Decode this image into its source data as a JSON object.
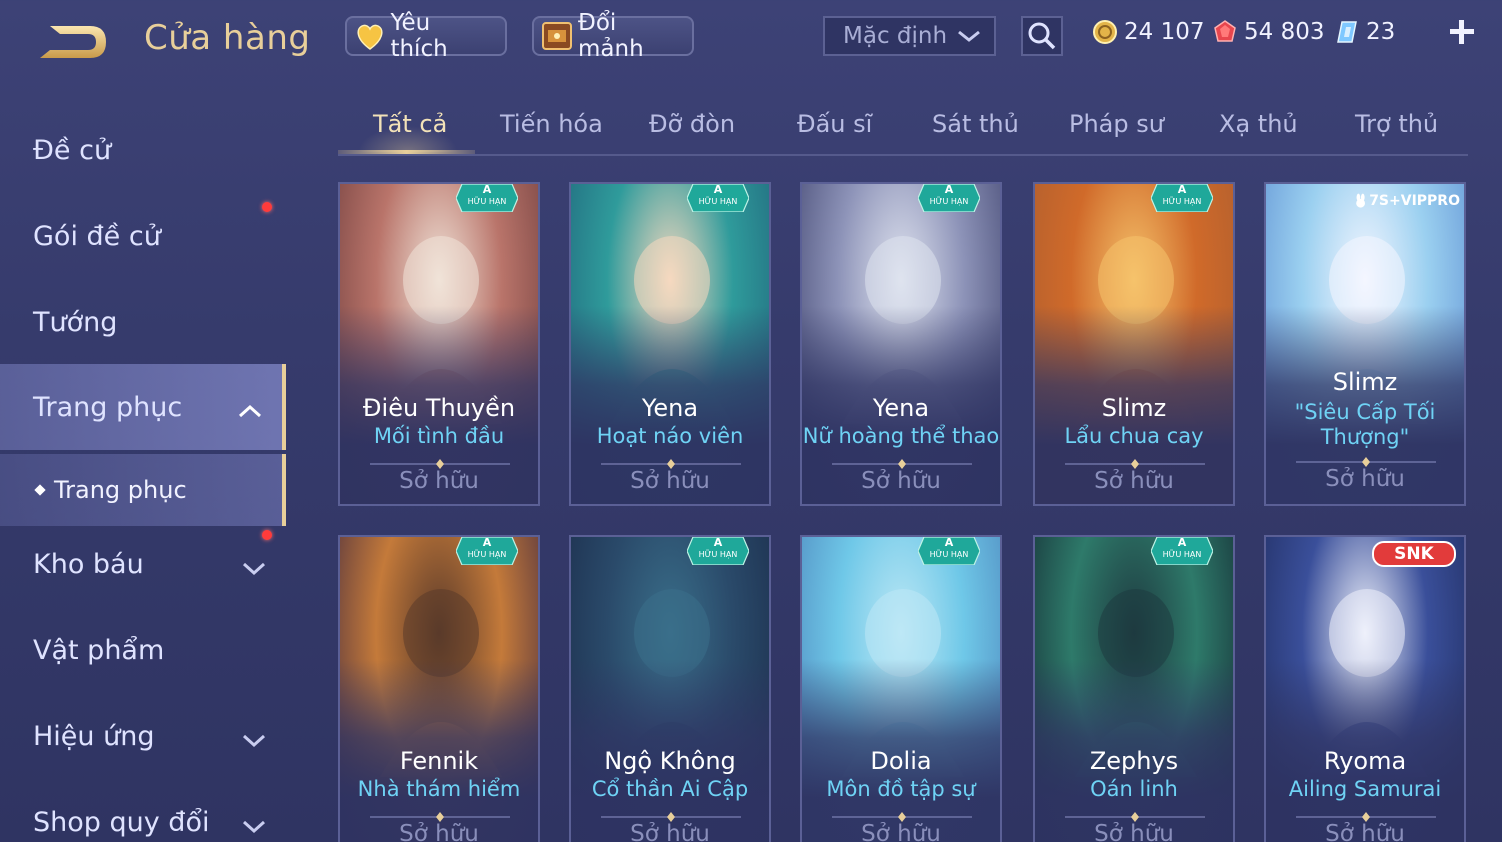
{
  "header": {
    "title": "Cửa hàng",
    "favorite_label": "Yêu thích",
    "exchange_label": "Đổi mảnh",
    "sort_value": "Mặc định",
    "currencies": [
      {
        "icon": "gold-coin-icon",
        "amount": "24 107"
      },
      {
        "icon": "ruby-icon",
        "amount": "54 803"
      },
      {
        "icon": "diamond-voucher-icon",
        "amount": "23"
      }
    ]
  },
  "sidebar": {
    "items": [
      {
        "label": "Đề cử"
      },
      {
        "label": "Gói đề cử"
      },
      {
        "label": "Tướng"
      },
      {
        "label": "Trang phục"
      },
      {
        "label": "Trang phục"
      },
      {
        "label": "Kho báu"
      },
      {
        "label": "Vật phẩm"
      },
      {
        "label": "Hiệu ứng"
      },
      {
        "label": "Shop quy đổi"
      }
    ]
  },
  "tabs": [
    {
      "label": "Tất cả",
      "active": true
    },
    {
      "label": "Tiến hóa"
    },
    {
      "label": "Đỡ đòn"
    },
    {
      "label": "Đấu sĩ"
    },
    {
      "label": "Sát thủ"
    },
    {
      "label": "Pháp sư"
    },
    {
      "label": "Xạ thủ"
    },
    {
      "label": "Trợ thủ"
    }
  ],
  "cards": [
    {
      "name": "Điêu Thuyền",
      "skin": "Mối tình đầu",
      "status": "Sở hữu",
      "badge": "A",
      "badge_sub": "HỮU HẠN"
    },
    {
      "name": "Yena",
      "skin": "Hoạt náo viên",
      "status": "Sở hữu",
      "badge": "A",
      "badge_sub": "HỮU HẠN"
    },
    {
      "name": "Yena",
      "skin": "Nữ hoàng thể thao",
      "status": "Sở hữu",
      "badge": "A",
      "badge_sub": "HỮU HẠN"
    },
    {
      "name": "Slimz",
      "skin": "Lẩu chua cay",
      "status": "Sở hữu",
      "badge": "A",
      "badge_sub": "HỮU HẠN"
    },
    {
      "name": "Slimz",
      "skin": "\"Siêu Cấp Tối Thượng\"",
      "status": "Sở hữu",
      "badge": "7S+VIPPRO"
    },
    {
      "name": "Fennik",
      "skin": "Nhà thám hiểm",
      "status": "Sở hữu",
      "badge": "A",
      "badge_sub": "HỮU HẠN"
    },
    {
      "name": "Ngộ Không",
      "skin": "Cổ thần Ai Cập",
      "status": "Sở hữu",
      "badge": "A",
      "badge_sub": "HỮU HẠN"
    },
    {
      "name": "Dolia",
      "skin": "Môn đồ tập sự",
      "status": "Sở hữu",
      "badge": "A",
      "badge_sub": "HỮU HẠN"
    },
    {
      "name": "Zephys",
      "skin": "Oán linh",
      "status": "Sở hữu",
      "badge": "A",
      "badge_sub": "HỮU HẠN"
    },
    {
      "name": "Ryoma",
      "skin": "Ailing Samurai",
      "status": "Sở hữu",
      "badge": "SNK"
    }
  ],
  "colors": {
    "background": "#363b6c",
    "gold_accent": "#e8cf9a",
    "skin_name": "#6fd3f5",
    "notification": "#ff3b3b",
    "badge_teal": "#1fa89a"
  }
}
